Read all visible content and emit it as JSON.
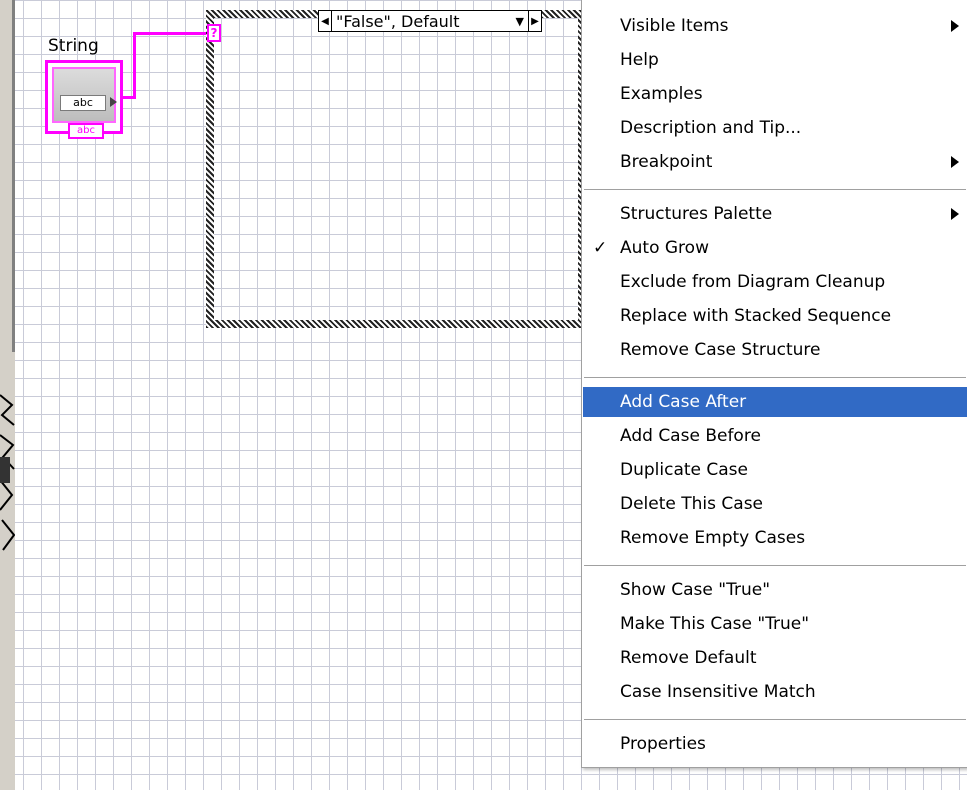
{
  "diagram": {
    "string_control": {
      "label": "String",
      "terminal_text": "abc",
      "terminal_tag": "abc"
    },
    "case_structure": {
      "selector_symbol": "?",
      "case_label": "\"False\", Default",
      "prev_arrow": "◀",
      "next_arrow": "▶",
      "dropdown_arrow": "▼"
    }
  },
  "context_menu": {
    "groups": [
      [
        {
          "label": "Visible Items",
          "submenu": true
        },
        {
          "label": "Help"
        },
        {
          "label": "Examples"
        },
        {
          "label": "Description and Tip..."
        },
        {
          "label": "Breakpoint",
          "submenu": true
        }
      ],
      [
        {
          "label": "Structures Palette",
          "submenu": true
        },
        {
          "label": "Auto Grow",
          "checked": true,
          "check_mark": "✓"
        },
        {
          "label": "Exclude from Diagram Cleanup"
        },
        {
          "label": "Replace with Stacked Sequence"
        },
        {
          "label": "Remove Case Structure"
        }
      ],
      [
        {
          "label": "Add Case After",
          "highlighted": true
        },
        {
          "label": "Add Case Before"
        },
        {
          "label": "Duplicate Case"
        },
        {
          "label": "Delete This Case"
        },
        {
          "label": "Remove Empty Cases"
        }
      ],
      [
        {
          "label": "Show Case \"True\""
        },
        {
          "label": "Make This Case \"True\""
        },
        {
          "label": "Remove Default"
        },
        {
          "label": "Case Insensitive Match"
        }
      ],
      [
        {
          "label": "Properties"
        }
      ]
    ],
    "highlight_color": "#316ac5"
  },
  "colors": {
    "wire_string": "#ff00ff",
    "grid_line": "#c9cbd8",
    "window_chrome": "#d4d0c8"
  }
}
